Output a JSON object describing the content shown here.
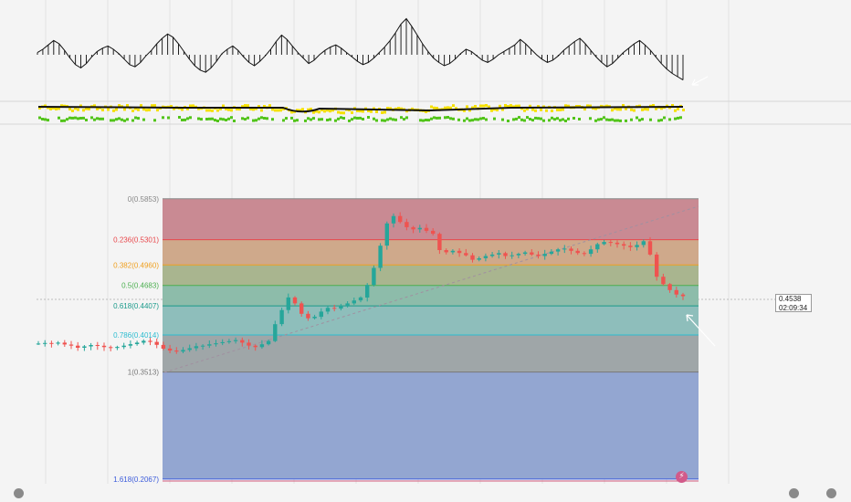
{
  "chart_data": [
    {
      "type": "histogram-oscillator",
      "title": "",
      "values": [
        0.2,
        0.5,
        0.9,
        1.3,
        1.0,
        0.4,
        -0.3,
        -0.9,
        -1.2,
        -0.8,
        -0.2,
        0.3,
        0.6,
        0.8,
        0.5,
        0.1,
        -0.4,
        -0.9,
        -1.1,
        -0.7,
        -0.1,
        0.4,
        1.0,
        1.5,
        1.9,
        1.6,
        1.0,
        0.3,
        -0.4,
        -1.0,
        -1.4,
        -1.6,
        -1.2,
        -0.6,
        0.1,
        0.5,
        0.8,
        0.4,
        -0.2,
        -0.7,
        -1.0,
        -0.6,
        -0.1,
        0.5,
        1.2,
        1.8,
        1.4,
        0.8,
        0.2,
        -0.3,
        -0.8,
        -0.5,
        0.0,
        0.4,
        0.7,
        0.9,
        0.6,
        0.2,
        -0.2,
        -0.6,
        -0.9,
        -0.7,
        -0.3,
        0.2,
        0.7,
        1.3,
        2.0,
        2.8,
        3.3,
        2.6,
        1.8,
        1.0,
        0.3,
        -0.3,
        -0.7,
        -1.0,
        -0.8,
        -0.4,
        0.1,
        0.5,
        0.3,
        -0.1,
        -0.5,
        -0.7,
        -0.4,
        0.0,
        0.3,
        0.6,
        0.9,
        1.4,
        1.0,
        0.5,
        0.0,
        -0.4,
        -0.7,
        -0.5,
        -0.1,
        0.4,
        0.8,
        1.2,
        1.5,
        1.0,
        0.4,
        -0.2,
        -0.7,
        -1.1,
        -0.8,
        -0.3,
        0.2,
        0.6,
        1.0,
        1.3,
        0.9,
        0.4,
        -0.2,
        -0.8,
        -1.3,
        -1.7,
        -2.0,
        -2.3
      ]
    },
    {
      "type": "scatter",
      "title": "",
      "series": [
        {
          "color": "#f5e000"
        },
        {
          "color": "#52c41a"
        }
      ]
    },
    {
      "type": "candlestick",
      "title": "",
      "colors": {
        "up": "#26a69a",
        "down": "#ef5350"
      },
      "close": [
        0.3898,
        0.3905,
        0.3896,
        0.391,
        0.3885,
        0.387,
        0.3842,
        0.386,
        0.3878,
        0.3868,
        0.385,
        0.3838,
        0.3852,
        0.387,
        0.389,
        0.391,
        0.3935,
        0.392,
        0.388,
        0.383,
        0.3803,
        0.379,
        0.3812,
        0.3835,
        0.3862,
        0.387,
        0.3888,
        0.3902,
        0.3916,
        0.393,
        0.3945,
        0.391,
        0.387,
        0.385,
        0.3888,
        0.3932,
        0.416,
        0.435,
        0.452,
        0.444,
        0.43,
        0.424,
        0.426,
        0.433,
        0.438,
        0.437,
        0.441,
        0.444,
        0.448,
        0.452,
        0.469,
        0.492,
        0.522,
        0.552,
        0.562,
        0.554,
        0.547,
        0.544,
        0.546,
        0.542,
        0.538,
        0.516,
        0.513,
        0.515,
        0.512,
        0.509,
        0.503,
        0.505,
        0.508,
        0.51,
        0.512,
        0.508,
        0.509,
        0.511,
        0.513,
        0.51,
        0.508,
        0.511,
        0.514,
        0.517,
        0.518,
        0.515,
        0.512,
        0.511,
        0.517,
        0.524,
        0.527,
        0.526,
        0.524,
        0.522,
        0.52,
        0.523,
        0.528,
        0.51,
        0.48,
        0.47,
        0.462,
        0.456,
        0.4538
      ],
      "ylim": [
        0.198,
        0.59
      ]
    }
  ],
  "fib_levels": [
    {
      "ratio": "0",
      "price": "0.5853",
      "label": "0(0.5853)",
      "color": "#888888",
      "fill": ""
    },
    {
      "ratio": "0.236",
      "price": "0.5301",
      "label": "0.236(0.5301)",
      "color": "#e8474b",
      "fill": "#c98a93"
    },
    {
      "ratio": "0.382",
      "price": "0.4960",
      "label": "0.382(0.4960)",
      "color": "#f0a020",
      "fill": "#cfa98b"
    },
    {
      "ratio": "0.5",
      "price": "0.4683",
      "label": "0.5(0.4683)",
      "color": "#4caf50",
      "fill": "#a9b58f"
    },
    {
      "ratio": "0.618",
      "price": "0.4407",
      "label": "0.618(0.4407)",
      "color": "#1a9a8a",
      "fill": "#8dbcaa"
    },
    {
      "ratio": "0.786",
      "price": "0.4014",
      "label": "0.786(0.4014)",
      "color": "#2cbcd0",
      "fill": "#8ebebb"
    },
    {
      "ratio": "1",
      "price": "0.3513",
      "label": "1(0.3513)",
      "color": "#777777",
      "fill": "#9fa6a8"
    },
    {
      "ratio": "1.618",
      "price": "0.2067",
      "label": "1.618(0.2067)",
      "color": "#3b5bdb",
      "fill": "#93a6d1"
    }
  ],
  "price_axis": {
    "last_price": "0.4538",
    "countdown": "02:09:34"
  }
}
